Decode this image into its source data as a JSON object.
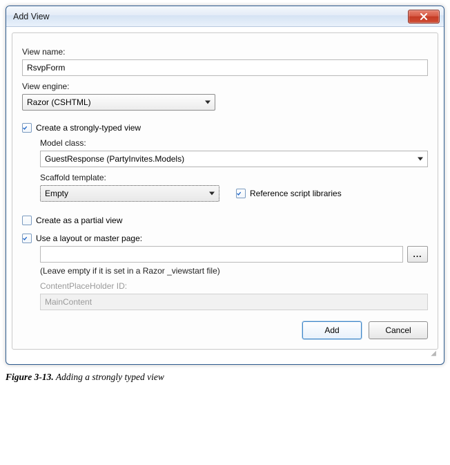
{
  "window": {
    "title": "Add View"
  },
  "fields": {
    "viewNameLabel": "View name:",
    "viewName": "RsvpForm",
    "viewEngineLabel": "View engine:",
    "viewEngine": "Razor (CSHTML)",
    "stronglyTypedLabel": "Create a strongly-typed view",
    "stronglyTypedChecked": true,
    "modelClassLabel": "Model class:",
    "modelClass": "GuestResponse (PartyInvites.Models)",
    "scaffoldLabel": "Scaffold template:",
    "scaffold": "Empty",
    "refScriptsLabel": "Reference script libraries",
    "refScriptsChecked": true,
    "partialLabel": "Create as a partial view",
    "partialChecked": false,
    "useLayoutLabel": "Use a layout or master page:",
    "useLayoutChecked": true,
    "layoutPath": "",
    "layoutHint": "(Leave empty if it is set in a Razor _viewstart file)",
    "cphLabel": "ContentPlaceHolder ID:",
    "cphValue": "MainContent",
    "browseLabel": "..."
  },
  "buttons": {
    "add": "Add",
    "cancel": "Cancel"
  },
  "caption": {
    "fignum": "Figure 3-13.",
    "text": " Adding a strongly typed view"
  }
}
